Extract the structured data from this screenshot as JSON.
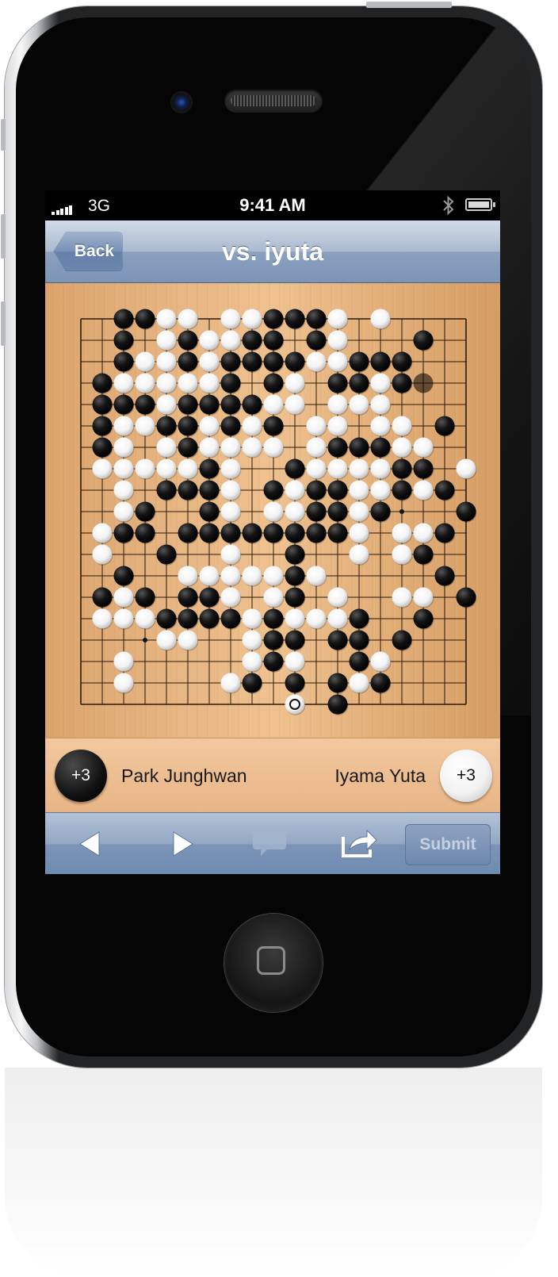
{
  "status_bar": {
    "carrier": "3G",
    "time": "9:41 AM",
    "bluetooth_icon": "bluetooth-icon",
    "battery_icon": "battery-icon",
    "signal_icon": "signal-bars-icon"
  },
  "navbar": {
    "back_label": "Back",
    "title": "vs. iyuta"
  },
  "board": {
    "size": 19,
    "hoshi": [
      [
        3,
        3
      ],
      [
        3,
        9
      ],
      [
        3,
        15
      ],
      [
        9,
        3
      ],
      [
        9,
        9
      ],
      [
        9,
        15
      ],
      [
        15,
        3
      ],
      [
        15,
        9
      ],
      [
        15,
        15
      ]
    ],
    "rows": [
      "..XXOO.OOXXXO.O....",
      "..X.OXOOXX.XO...X..",
      "..XOOXOXXXXOOXXX...",
      ".XOOOOOX.XO.XXOX...",
      ".XXXOXXXXOO.OOO....",
      ".XOOXXOXOX.OO.OO.X.",
      ".XO.OXOOOO.OXXXOO..",
      ".OOOOOXO..XOOOOXX.O",
      "..O.XXXO.XOXXOOXOX.",
      "..OX..XO.OOXXOX...X",
      ".OXX.XXXXXXXXO.OOX.",
      ".O..X..O..X..O.OX..",
      "..X..OOOOOXO.....X.",
      ".XOX.XXO.OX.O..OO.X",
      ".OOOXXXXOXOOOX..X..",
      "....OO..OXX.XX.X...",
      "..O.....OXO..XO....",
      "..O....OX.X.XOX....",
      "..........O.X......"
    ],
    "last_move": [
      18,
      10
    ],
    "ghost_black": [
      [
        1,
        16
      ],
      [
        2,
        14
      ],
      [
        2,
        15
      ],
      [
        3,
        16
      ]
    ]
  },
  "players": {
    "black_name": "Park Junghwan",
    "black_captures": "+3",
    "white_name": "Iyama Yuta",
    "white_captures": "+3"
  },
  "toolbar": {
    "prev_icon": "prev-move-icon",
    "next_icon": "next-move-icon",
    "chat_icon": "chat-bubble-icon",
    "share_icon": "share-icon",
    "submit_label": "Submit"
  },
  "colors": {
    "board_wood": "#e6b683",
    "nav_blue": "#8aa0bf",
    "player_bar": "#eebf92"
  }
}
